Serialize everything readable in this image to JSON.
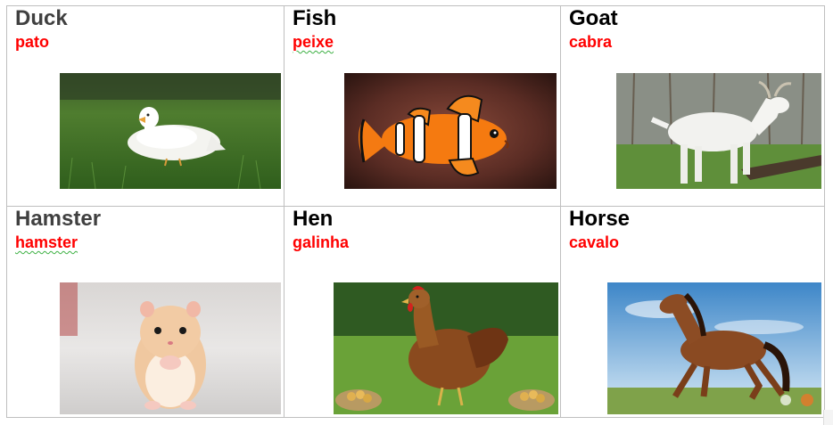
{
  "animals": [
    {
      "english": "Duck",
      "english_color": "#404040",
      "portuguese": "pato",
      "portuguese_flagged": false,
      "image": "duck-photo"
    },
    {
      "english": "Fish",
      "english_color": "#000000",
      "portuguese": "peixe",
      "portuguese_flagged": true,
      "image": "clownfish-photo"
    },
    {
      "english": "Goat",
      "english_color": "#000000",
      "portuguese": "cabra",
      "portuguese_flagged": false,
      "image": "goat-photo"
    },
    {
      "english": "Hamster",
      "english_color": "#404040",
      "portuguese": "hamster",
      "portuguese_flagged": true,
      "image": "hamster-photo"
    },
    {
      "english": "Hen",
      "english_color": "#000000",
      "portuguese": "galinha",
      "portuguese_flagged": false,
      "image": "hen-photo"
    },
    {
      "english": "Horse",
      "english_color": "#000000",
      "portuguese": "cavalo",
      "portuguese_flagged": false,
      "image": "horse-photo"
    }
  ],
  "colors": {
    "portuguese_text": "#ff0000",
    "cell_border": "#bfbfbf",
    "spellcheck_underline": "#3cb043"
  }
}
